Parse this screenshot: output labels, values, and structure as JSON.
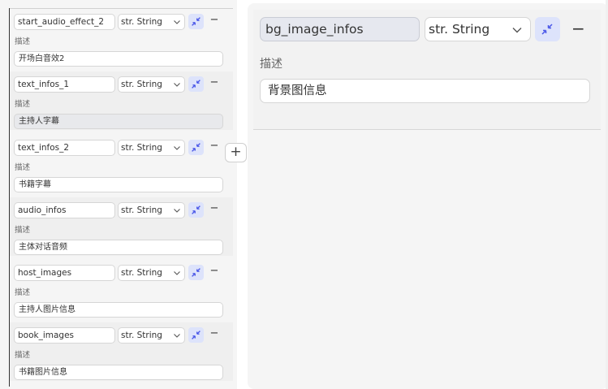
{
  "type_label": "str. String",
  "desc_label": "描述",
  "remove_glyph": "−",
  "add_glyph": "+",
  "fields": [
    {
      "name": "start_audio_effect_2",
      "description": "开场白音效2"
    },
    {
      "name": "text_infos_1",
      "description": "主持人字幕"
    },
    {
      "name": "text_infos_2",
      "description": "书籍字幕"
    },
    {
      "name": "audio_infos",
      "description": "主体对话音频"
    },
    {
      "name": "host_images",
      "description": "主持人图片信息"
    },
    {
      "name": "book_images",
      "description": "书籍图片信息"
    }
  ],
  "detail": {
    "name": "bg_image_infos",
    "description": "背景图信息"
  },
  "icons": {
    "collapse": "collapse-arrows-icon",
    "dropdown": "chevron-down-icon",
    "remove": "minus-icon",
    "add": "plus-icon"
  },
  "colors": {
    "accent_bg": "#dde3fb",
    "accent_icon": "#4a57e8"
  }
}
